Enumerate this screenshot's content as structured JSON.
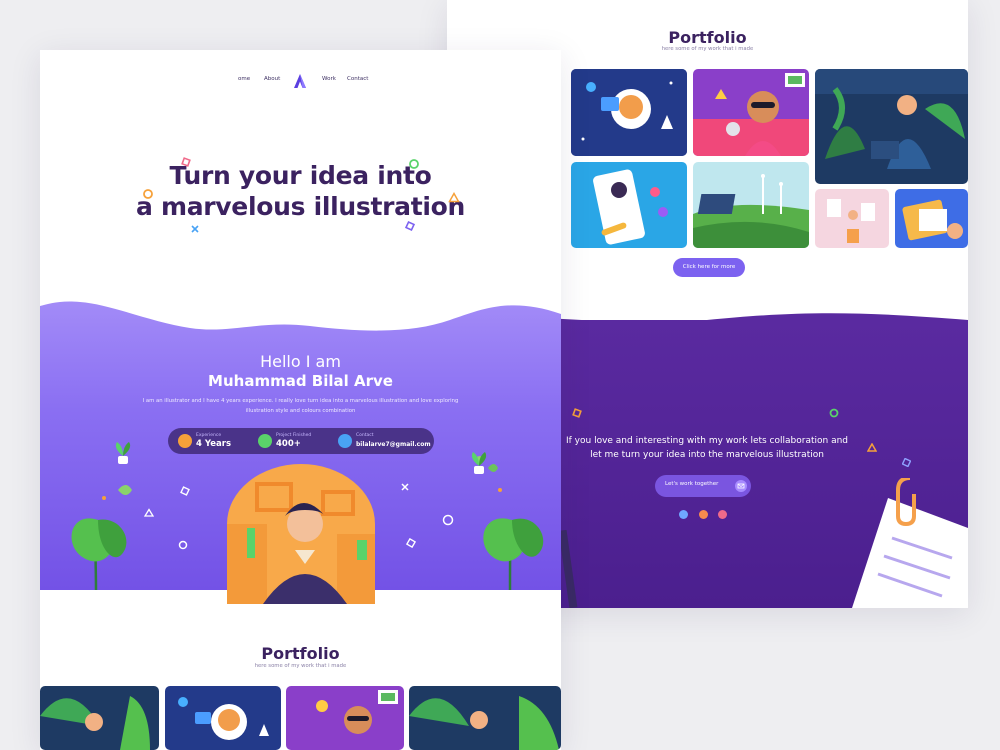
{
  "left_page": {
    "nav": {
      "home": "ome",
      "about": "About",
      "work": "Work",
      "contact": "Contact",
      "logo": "A"
    },
    "hero": {
      "title_line1": "Turn your idea into",
      "title_line2": "a marvelous illustration"
    },
    "intro": {
      "hello": "Hello I am",
      "name": "Muhammad Bilal Arve",
      "description": "I am an illustrator and I have 4 years experience. I really love turn idea into a marvelous illustration and love exploring illustration style and colours combination"
    },
    "stats": [
      {
        "label": "Experience",
        "value": "4 Years",
        "icon": "trophy-icon",
        "color": "#f6a13a"
      },
      {
        "label": "Project Finished",
        "value": "400+",
        "icon": "check-icon",
        "color": "#5ad36a"
      },
      {
        "label": "Contact",
        "value": "bilalarve7@gmail.com",
        "icon": "mail-icon",
        "color": "#49a3f5"
      }
    ],
    "portfolio": {
      "title": "Portfolio",
      "subtitle": "here some of my work that i made"
    }
  },
  "right_page": {
    "portfolio": {
      "title": "Portfolio",
      "subtitle": "here some of my work that i made",
      "more_button": "Click here for more"
    },
    "collab": {
      "line1": "If you love and interesting with my work lets collaboration and",
      "line2": "let me turn your idea into the marvelous illustration",
      "button": "Let's work together",
      "button_icon": "mail-icon"
    },
    "social_icons": [
      {
        "name": "dribbble-icon",
        "color": "#6fa8ff"
      },
      {
        "name": "behance-icon",
        "color": "#f68b4e"
      },
      {
        "name": "instagram-icon",
        "color": "#f06a8a"
      }
    ]
  },
  "colors": {
    "primary_purple": "#7c62f0",
    "dark_purple": "#4b1f8e",
    "title_color": "#3b2260",
    "accent_orange": "#f6a13a",
    "accent_green": "#5ad36a"
  }
}
